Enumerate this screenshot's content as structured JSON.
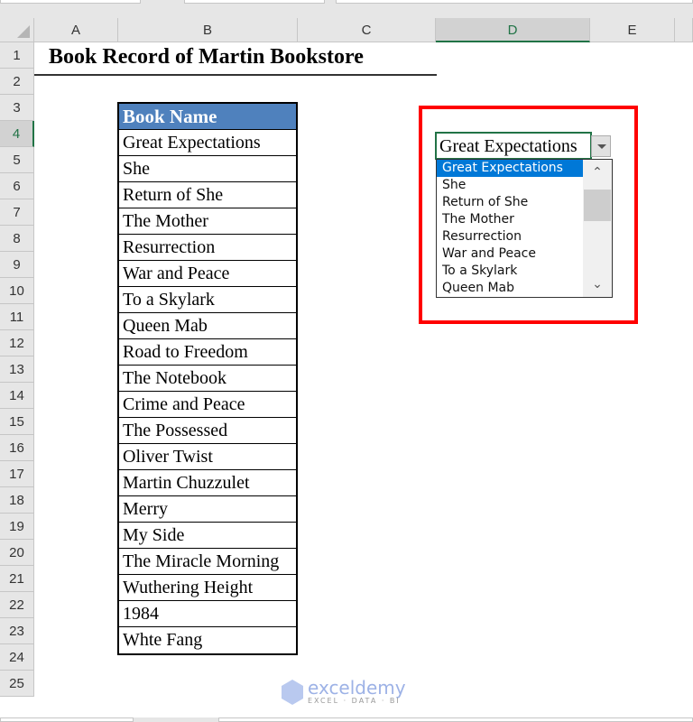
{
  "columns": [
    "A",
    "B",
    "C",
    "D",
    "E"
  ],
  "selected_column": "D",
  "rows": [
    "1",
    "2",
    "3",
    "4",
    "5",
    "6",
    "7",
    "8",
    "9",
    "10",
    "11",
    "12",
    "13",
    "14",
    "15",
    "16",
    "17",
    "18",
    "19",
    "20",
    "21",
    "22",
    "23",
    "24",
    "25"
  ],
  "selected_row": "4",
  "sheet": {
    "title": "Book Record of Martin Bookstore",
    "table_header": "Book Name",
    "books": [
      "Great Expectations",
      "She",
      "Return of She",
      "The Mother",
      "Resurrection",
      "War and Peace",
      "To a Skylark",
      "Queen Mab",
      "Road to Freedom",
      "The Notebook",
      "Crime and Peace",
      "The Possessed",
      "Oliver Twist",
      "Martin Chuzzulet",
      "Merry",
      "My Side",
      "The Miracle Morning",
      "Wuthering Height",
      "1984",
      "Whte Fang"
    ]
  },
  "dropdown": {
    "value": "Great Expectations",
    "options": [
      "Great Expectations",
      "She",
      "Return of She",
      "The Mother",
      "Resurrection",
      "War and Peace",
      "To a Skylark",
      "Queen Mab"
    ],
    "selected_index": 0
  },
  "watermark": {
    "name": "exceldemy",
    "tagline": "EXCEL · DATA · BI"
  },
  "colors": {
    "header_fill": "#4f81bd",
    "highlight_box": "#ff0000",
    "selection": "#217346",
    "list_active": "#0078d7"
  }
}
